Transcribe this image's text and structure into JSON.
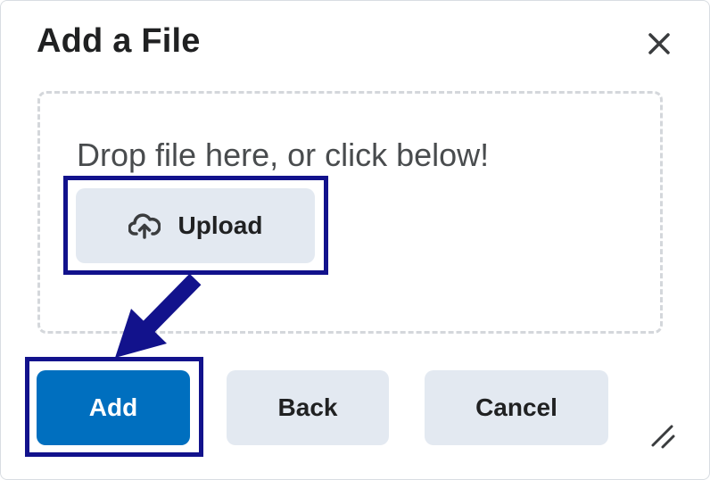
{
  "dialog": {
    "title": "Add a File",
    "close_icon": "close-icon"
  },
  "dropzone": {
    "prompt": "Drop file here, or click below!",
    "upload_label": "Upload",
    "upload_icon": "cloud-upload-icon"
  },
  "actions": {
    "add_label": "Add",
    "back_label": "Back",
    "cancel_label": "Cancel"
  },
  "annotations": {
    "highlight_color": "#12128c",
    "arrow": "from Upload button to Add button"
  },
  "colors": {
    "primary": "#006fbf",
    "secondary": "#e3e9f1",
    "text": "#202122"
  }
}
